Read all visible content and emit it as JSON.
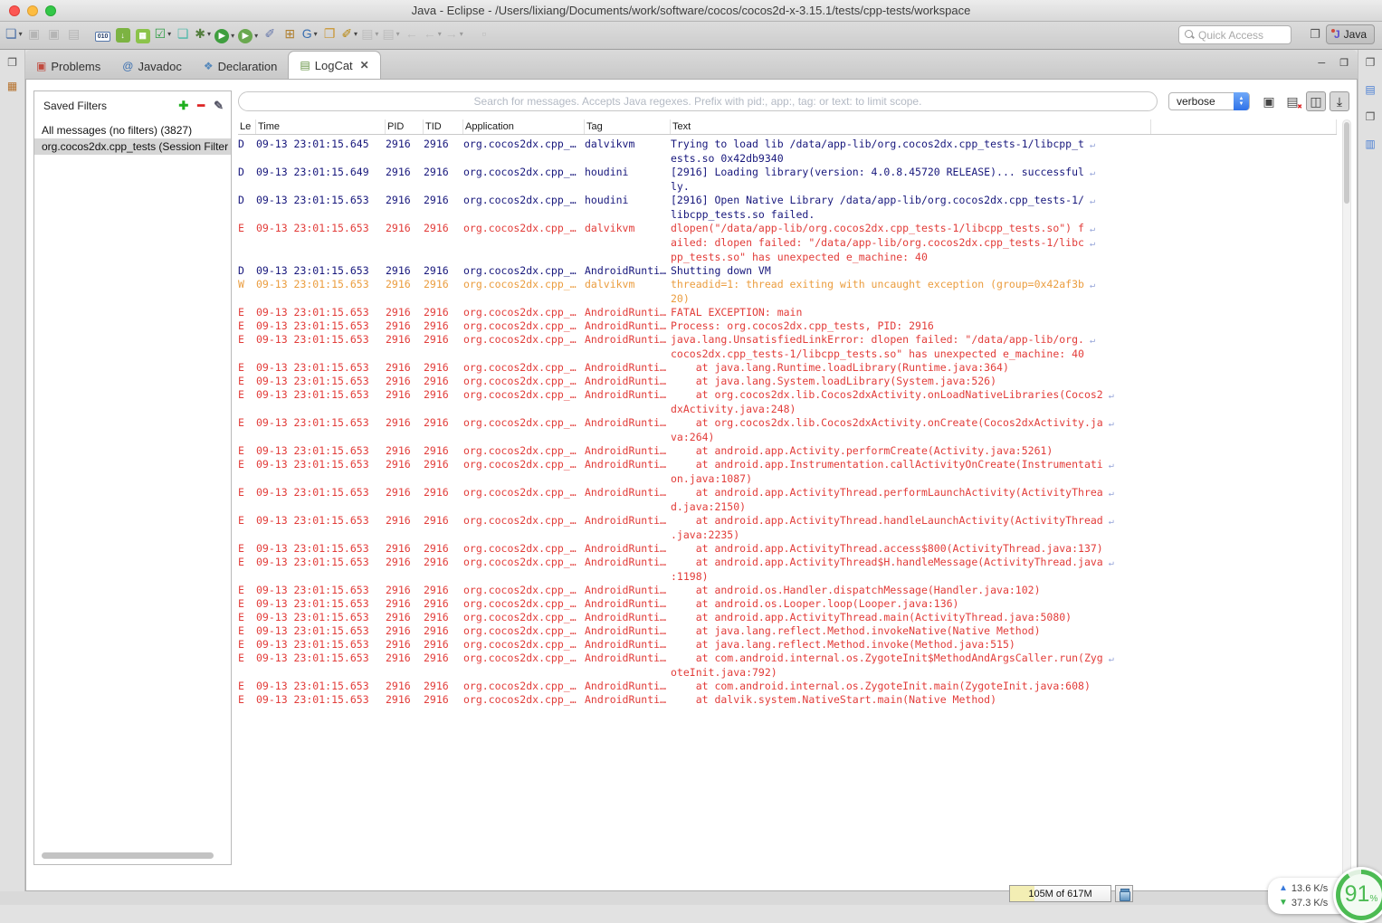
{
  "window": {
    "title": "Java - Eclipse - /Users/lixiang/Documents/work/software/cocos/cocos2d-x-3.15.1/tests/cpp-tests/workspace"
  },
  "toolbar": {
    "quick_access_placeholder": "Quick Access",
    "perspective_label": "Java",
    "items": [
      {
        "name": "new-wizard",
        "glyph": "❏",
        "color": "#4a6fa5",
        "dropdown": true
      },
      {
        "name": "save",
        "glyph": "▣",
        "color": "#888888",
        "disabled": true
      },
      {
        "name": "save-all",
        "glyph": "▣",
        "color": "#888888",
        "disabled": true
      },
      {
        "name": "print",
        "glyph": "▤",
        "color": "#888888",
        "disabled": true
      },
      {
        "sep": true
      },
      {
        "name": "binary-file",
        "bin": "010"
      },
      {
        "name": "android-sdk-manager",
        "glyph": "↓",
        "chip": "#7cb342"
      },
      {
        "name": "android-avd-manager",
        "glyph": "▦",
        "chip": "#8bc34a"
      },
      {
        "name": "junit-test",
        "glyph": "☑",
        "color": "#2f9e44",
        "dropdown": true
      },
      {
        "name": "new-android-project",
        "glyph": "❏",
        "color": "#49b8a8"
      },
      {
        "name": "debug",
        "glyph": "✱",
        "color": "#557f3f",
        "dropdown": true
      },
      {
        "name": "run",
        "glyph": "▶",
        "chip": "#3f9e3f",
        "chipround": true,
        "dropdown": true
      },
      {
        "name": "run-external-tools",
        "glyph": "▶",
        "chip": "#6aa84f",
        "chipround": true,
        "dropdown": true
      },
      {
        "name": "skip-breakpoints",
        "glyph": "✐",
        "color": "#6677aa"
      },
      {
        "name": "new-java-package",
        "glyph": "⊞",
        "color": "#b08030"
      },
      {
        "name": "new-java-class",
        "glyph": "G",
        "color": "#3a6fb0",
        "dropdown": true
      },
      {
        "name": "open-resource",
        "glyph": "❐",
        "color": "#c9942e"
      },
      {
        "name": "search",
        "glyph": "✐",
        "color": "#b8860b",
        "dropdown": true
      },
      {
        "name": "last-edit-location",
        "glyph": "▤",
        "color": "#9a9a9a",
        "dropdown": true,
        "disabled": true
      },
      {
        "name": "next-annotation",
        "glyph": "▤",
        "color": "#9a9a9a",
        "dropdown": true,
        "disabled": true
      },
      {
        "name": "back-history",
        "glyph": "←",
        "color": "#9a9a9a",
        "disabled": true
      },
      {
        "name": "back",
        "glyph": "←",
        "color": "#9a9a9a",
        "dropdown": true,
        "disabled": true
      },
      {
        "name": "forward",
        "glyph": "→",
        "color": "#9a9a9a",
        "dropdown": true,
        "disabled": true
      },
      {
        "sep": true
      },
      {
        "name": "link-editor",
        "glyph": "▫",
        "color": "#9a9a9a",
        "disabled": true
      }
    ]
  },
  "minibars": {
    "left": [
      {
        "name": "restore-minimized-view",
        "glyph": "❐",
        "color": "#555555"
      },
      {
        "name": "devices-view",
        "glyph": "▦",
        "color": "#b5702a"
      }
    ],
    "right": [
      {
        "name": "restore-minimized-view",
        "glyph": "❐",
        "color": "#555555"
      },
      {
        "name": "outline-view",
        "glyph": "▤",
        "color": "#4a7fd4"
      },
      {
        "name": "restore-minimized-view-2",
        "glyph": "❐",
        "color": "#555555"
      },
      {
        "name": "layout-view",
        "glyph": "▥",
        "color": "#4a7fd4"
      }
    ]
  },
  "tabs": [
    {
      "label": "Problems",
      "icon": "▣",
      "icon_color": "#c04a3e",
      "active": false
    },
    {
      "label": "Javadoc",
      "icon": "@",
      "icon_color": "#3a6fb0",
      "active": false
    },
    {
      "label": "Declaration",
      "icon": "❖",
      "icon_color": "#5588bb",
      "active": false
    },
    {
      "label": "LogCat",
      "icon": "▤",
      "icon_color": "#5f8f3e",
      "active": true,
      "closable": true
    }
  ],
  "view_controls": {
    "minimize": "─",
    "maximize": "❐"
  },
  "filters": {
    "title": "Saved Filters",
    "actions": {
      "add": "✚",
      "remove": "━",
      "edit": "✎"
    },
    "items": [
      {
        "label": "All messages (no filters) (3827)",
        "selected": false
      },
      {
        "label": "org.cocos2dx.cpp_tests (Session Filter",
        "selected": true
      }
    ]
  },
  "logcat": {
    "search_placeholder": "Search for messages. Accepts Java regexes. Prefix with pid:, app:, tag: or text: to limit scope.",
    "level_filter": "verbose",
    "action_icons": [
      {
        "name": "save-log",
        "glyph": "▣",
        "color": "#444444",
        "toggled": false
      },
      {
        "name": "clear-log",
        "glyph": "▤",
        "color": "#444444",
        "clear": true,
        "toggled": false
      },
      {
        "name": "display-saved-filters-view",
        "glyph": "◫",
        "color": "#444444",
        "toggled": true
      },
      {
        "name": "autoscroll",
        "glyph": "⤓",
        "color": "#222222",
        "toggled": true
      }
    ],
    "columns": [
      "Le",
      "Time",
      "PID",
      "TID",
      "Application",
      "Tag",
      "Text"
    ],
    "level_colors": {
      "D": "#17177c",
      "E": "#e23c39",
      "W": "#eb9d3f"
    },
    "wrap_marker": "↵",
    "rows": [
      {
        "level": "D",
        "time": "09-13 23:01:15.645",
        "pid": "2916",
        "tid": "2916",
        "app": "org.cocos2dx.cpp_…",
        "tag": "dalvikvm",
        "lines": [
          "Trying to load lib /data/app-lib/org.cocos2dx.cpp_tests-1/libcpp_t",
          "ests.so 0x42db9340"
        ]
      },
      {
        "level": "D",
        "time": "09-13 23:01:15.649",
        "pid": "2916",
        "tid": "2916",
        "app": "org.cocos2dx.cpp_…",
        "tag": "houdini",
        "lines": [
          "[2916] Loading library(version: 4.0.8.45720 RELEASE)... successful",
          "ly."
        ]
      },
      {
        "level": "D",
        "time": "09-13 23:01:15.653",
        "pid": "2916",
        "tid": "2916",
        "app": "org.cocos2dx.cpp_…",
        "tag": "houdini",
        "lines": [
          "[2916] Open Native Library /data/app-lib/org.cocos2dx.cpp_tests-1/",
          "libcpp_tests.so failed."
        ]
      },
      {
        "level": "E",
        "time": "09-13 23:01:15.653",
        "pid": "2916",
        "tid": "2916",
        "app": "org.cocos2dx.cpp_…",
        "tag": "dalvikvm",
        "lines": [
          "dlopen(\"/data/app-lib/org.cocos2dx.cpp_tests-1/libcpp_tests.so\") f",
          "ailed: dlopen failed: \"/data/app-lib/org.cocos2dx.cpp_tests-1/libc",
          "pp_tests.so\" has unexpected e_machine: 40"
        ]
      },
      {
        "level": "D",
        "time": "09-13 23:01:15.653",
        "pid": "2916",
        "tid": "2916",
        "app": "org.cocos2dx.cpp_…",
        "tag": "AndroidRunti…",
        "lines": [
          "Shutting down VM"
        ]
      },
      {
        "level": "W",
        "time": "09-13 23:01:15.653",
        "pid": "2916",
        "tid": "2916",
        "app": "org.cocos2dx.cpp_…",
        "tag": "dalvikvm",
        "lines": [
          "threadid=1: thread exiting with uncaught exception (group=0x42af3b",
          "20)"
        ]
      },
      {
        "level": "E",
        "time": "09-13 23:01:15.653",
        "pid": "2916",
        "tid": "2916",
        "app": "org.cocos2dx.cpp_…",
        "tag": "AndroidRunti…",
        "lines": [
          "FATAL EXCEPTION: main"
        ]
      },
      {
        "level": "E",
        "time": "09-13 23:01:15.653",
        "pid": "2916",
        "tid": "2916",
        "app": "org.cocos2dx.cpp_…",
        "tag": "AndroidRunti…",
        "lines": [
          "Process: org.cocos2dx.cpp_tests, PID: 2916"
        ]
      },
      {
        "level": "E",
        "time": "09-13 23:01:15.653",
        "pid": "2916",
        "tid": "2916",
        "app": "org.cocos2dx.cpp_…",
        "tag": "AndroidRunti…",
        "lines": [
          "java.lang.UnsatisfiedLinkError: dlopen failed: \"/data/app-lib/org.",
          "cocos2dx.cpp_tests-1/libcpp_tests.so\" has unexpected e_machine: 40"
        ]
      },
      {
        "level": "E",
        "time": "09-13 23:01:15.653",
        "pid": "2916",
        "tid": "2916",
        "app": "org.cocos2dx.cpp_…",
        "tag": "AndroidRunti…",
        "lines": [
          "    at java.lang.Runtime.loadLibrary(Runtime.java:364)"
        ]
      },
      {
        "level": "E",
        "time": "09-13 23:01:15.653",
        "pid": "2916",
        "tid": "2916",
        "app": "org.cocos2dx.cpp_…",
        "tag": "AndroidRunti…",
        "lines": [
          "    at java.lang.System.loadLibrary(System.java:526)"
        ]
      },
      {
        "level": "E",
        "time": "09-13 23:01:15.653",
        "pid": "2916",
        "tid": "2916",
        "app": "org.cocos2dx.cpp_…",
        "tag": "AndroidRunti…",
        "lines": [
          "    at org.cocos2dx.lib.Cocos2dxActivity.onLoadNativeLibraries(Cocos2",
          "dxActivity.java:248)"
        ]
      },
      {
        "level": "E",
        "time": "09-13 23:01:15.653",
        "pid": "2916",
        "tid": "2916",
        "app": "org.cocos2dx.cpp_…",
        "tag": "AndroidRunti…",
        "lines": [
          "    at org.cocos2dx.lib.Cocos2dxActivity.onCreate(Cocos2dxActivity.ja",
          "va:264)"
        ]
      },
      {
        "level": "E",
        "time": "09-13 23:01:15.653",
        "pid": "2916",
        "tid": "2916",
        "app": "org.cocos2dx.cpp_…",
        "tag": "AndroidRunti…",
        "lines": [
          "    at android.app.Activity.performCreate(Activity.java:5261)"
        ]
      },
      {
        "level": "E",
        "time": "09-13 23:01:15.653",
        "pid": "2916",
        "tid": "2916",
        "app": "org.cocos2dx.cpp_…",
        "tag": "AndroidRunti…",
        "lines": [
          "    at android.app.Instrumentation.callActivityOnCreate(Instrumentati",
          "on.java:1087)"
        ]
      },
      {
        "level": "E",
        "time": "09-13 23:01:15.653",
        "pid": "2916",
        "tid": "2916",
        "app": "org.cocos2dx.cpp_…",
        "tag": "AndroidRunti…",
        "lines": [
          "    at android.app.ActivityThread.performLaunchActivity(ActivityThrea",
          "d.java:2150)"
        ]
      },
      {
        "level": "E",
        "time": "09-13 23:01:15.653",
        "pid": "2916",
        "tid": "2916",
        "app": "org.cocos2dx.cpp_…",
        "tag": "AndroidRunti…",
        "lines": [
          "    at android.app.ActivityThread.handleLaunchActivity(ActivityThread",
          ".java:2235)"
        ]
      },
      {
        "level": "E",
        "time": "09-13 23:01:15.653",
        "pid": "2916",
        "tid": "2916",
        "app": "org.cocos2dx.cpp_…",
        "tag": "AndroidRunti…",
        "lines": [
          "    at android.app.ActivityThread.access$800(ActivityThread.java:137)"
        ]
      },
      {
        "level": "E",
        "time": "09-13 23:01:15.653",
        "pid": "2916",
        "tid": "2916",
        "app": "org.cocos2dx.cpp_…",
        "tag": "AndroidRunti…",
        "lines": [
          "    at android.app.ActivityThread$H.handleMessage(ActivityThread.java",
          ":1198)"
        ]
      },
      {
        "level": "E",
        "time": "09-13 23:01:15.653",
        "pid": "2916",
        "tid": "2916",
        "app": "org.cocos2dx.cpp_…",
        "tag": "AndroidRunti…",
        "lines": [
          "    at android.os.Handler.dispatchMessage(Handler.java:102)"
        ]
      },
      {
        "level": "E",
        "time": "09-13 23:01:15.653",
        "pid": "2916",
        "tid": "2916",
        "app": "org.cocos2dx.cpp_…",
        "tag": "AndroidRunti…",
        "lines": [
          "    at android.os.Looper.loop(Looper.java:136)"
        ]
      },
      {
        "level": "E",
        "time": "09-13 23:01:15.653",
        "pid": "2916",
        "tid": "2916",
        "app": "org.cocos2dx.cpp_…",
        "tag": "AndroidRunti…",
        "lines": [
          "    at android.app.ActivityThread.main(ActivityThread.java:5080)"
        ]
      },
      {
        "level": "E",
        "time": "09-13 23:01:15.653",
        "pid": "2916",
        "tid": "2916",
        "app": "org.cocos2dx.cpp_…",
        "tag": "AndroidRunti…",
        "lines": [
          "    at java.lang.reflect.Method.invokeNative(Native Method)"
        ]
      },
      {
        "level": "E",
        "time": "09-13 23:01:15.653",
        "pid": "2916",
        "tid": "2916",
        "app": "org.cocos2dx.cpp_…",
        "tag": "AndroidRunti…",
        "lines": [
          "    at java.lang.reflect.Method.invoke(Method.java:515)"
        ]
      },
      {
        "level": "E",
        "time": "09-13 23:01:15.653",
        "pid": "2916",
        "tid": "2916",
        "app": "org.cocos2dx.cpp_…",
        "tag": "AndroidRunti…",
        "lines": [
          "    at com.android.internal.os.ZygoteInit$MethodAndArgsCaller.run(Zyg",
          "oteInit.java:792)"
        ]
      },
      {
        "level": "E",
        "time": "09-13 23:01:15.653",
        "pid": "2916",
        "tid": "2916",
        "app": "org.cocos2dx.cpp_…",
        "tag": "AndroidRunti…",
        "lines": [
          "    at com.android.internal.os.ZygoteInit.main(ZygoteInit.java:608)"
        ]
      },
      {
        "level": "E",
        "time": "09-13 23:01:15.653",
        "pid": "2916",
        "tid": "2916",
        "app": "org.cocos2dx.cpp_…",
        "tag": "AndroidRunti…",
        "lines": [
          "    at dalvik.system.NativeStart.main(Native Method)"
        ]
      }
    ]
  },
  "status_bar": {
    "heap_label": "105M of 617M"
  },
  "net_monitor": {
    "up": "13.6 K/s",
    "down": "37.3 K/s",
    "percent": "91",
    "percent_sign": "%"
  }
}
